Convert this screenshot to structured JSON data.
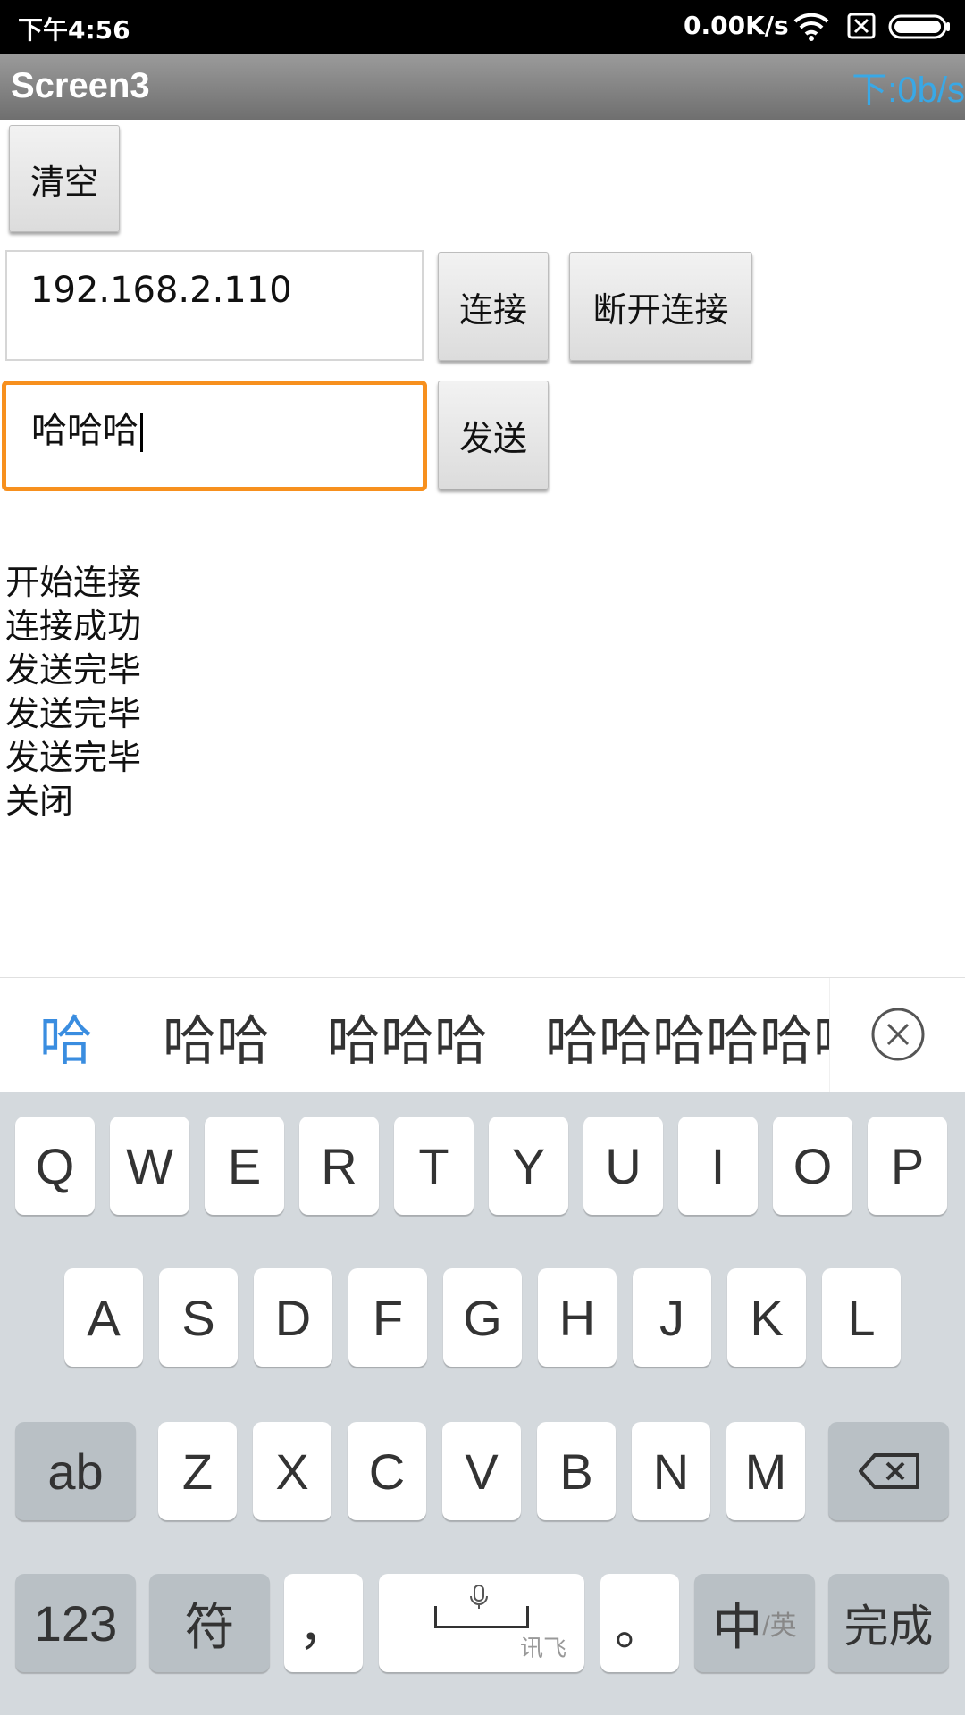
{
  "status_bar": {
    "time": "下午4:56",
    "speed": "0.00K/s",
    "icons": [
      "wifi-icon",
      "no-sim-icon",
      "battery-icon"
    ]
  },
  "title_bar": {
    "title": "Screen3",
    "net_speed": "下:0b/s"
  },
  "buttons": {
    "clear": "清空",
    "connect": "连接",
    "disconnect": "断开连接",
    "send": "发送"
  },
  "inputs": {
    "ip_value": "192.168.2.110",
    "message_value": "哈哈哈"
  },
  "log": [
    "开始连接",
    "连接成功",
    "发送完毕",
    "发送完毕",
    "发送完毕",
    "关闭"
  ],
  "candidates": [
    "哈",
    "哈哈",
    "哈哈哈",
    "哈哈哈哈哈哈"
  ],
  "keyboard": {
    "row1": [
      "Q",
      "W",
      "E",
      "R",
      "T",
      "Y",
      "U",
      "I",
      "O",
      "P"
    ],
    "row2": [
      "A",
      "S",
      "D",
      "F",
      "G",
      "H",
      "J",
      "K",
      "L"
    ],
    "row3": [
      "Z",
      "X",
      "C",
      "V",
      "B",
      "N",
      "M"
    ],
    "ab": "ab",
    "num": "123",
    "symbol": "符",
    "comma": "，",
    "space_brand": "讯飞",
    "period": "。",
    "lang_main": "中",
    "lang_sub": "/英",
    "done": "完成"
  },
  "colors": {
    "accent_blue": "#3a8de0",
    "focus_orange": "#f7901e",
    "netspeed_blue": "#39a8e6"
  }
}
